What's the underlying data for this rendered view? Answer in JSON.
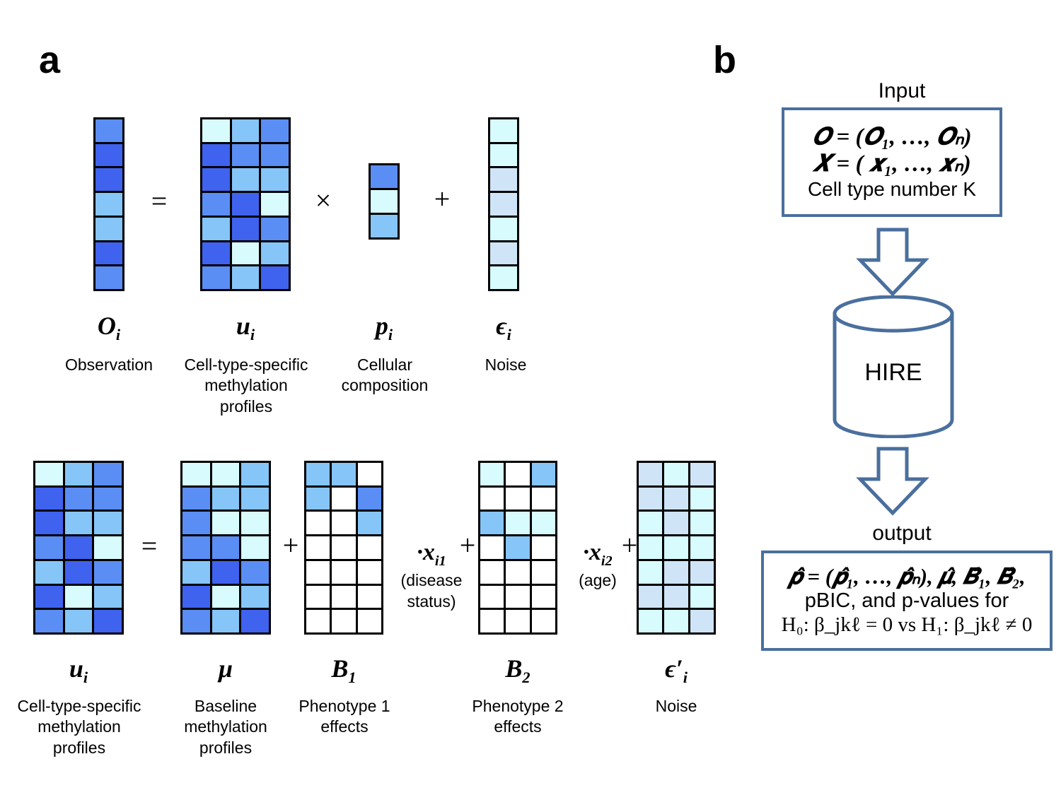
{
  "panels": {
    "a_letter": "a",
    "b_letter": "b"
  },
  "panel_a": {
    "row1": {
      "operators": {
        "equals": "=",
        "times": "×",
        "plus": "+"
      },
      "terms": [
        {
          "symbol_base": "O",
          "symbol_sub": "i",
          "caption": "Observation"
        },
        {
          "symbol_base": "u",
          "symbol_sub": "i",
          "caption": "Cell-type-specific\nmethylation\nprofiles"
        },
        {
          "symbol_base": "p",
          "symbol_sub": "i",
          "caption": "Cellular\ncomposition"
        },
        {
          "symbol_base": "ϵ",
          "symbol_sub": "i",
          "caption": "Noise"
        }
      ]
    },
    "row2": {
      "operators": {
        "equals": "=",
        "plus1": "+",
        "plus2": "+",
        "plus3": "+",
        "dot1": "·",
        "dot2": "·"
      },
      "covariates": [
        {
          "symbol_base": "x",
          "symbol_sub": "i1",
          "note": "(disease\nstatus)"
        },
        {
          "symbol_base": "x",
          "symbol_sub": "i2",
          "note": "(age)"
        }
      ],
      "terms": [
        {
          "symbol_base": "u",
          "symbol_sub": "i",
          "caption": "Cell-type-specific\nmethylation\nprofiles"
        },
        {
          "symbol_base": "μ",
          "symbol_sub": "",
          "caption": "Baseline\nmethylation\nprofiles"
        },
        {
          "symbol_base": "B",
          "symbol_sub": "1",
          "caption": "Phenotype 1\neffects"
        },
        {
          "symbol_base": "B",
          "symbol_sub": "2",
          "caption": "Phenotype 2\neffects"
        },
        {
          "symbol_base": "ϵ′",
          "symbol_sub": "i",
          "caption": "Noise"
        }
      ]
    }
  },
  "panel_b": {
    "input_title": "Input",
    "input_lines": [
      "𝑶 = (𝑶₁, …, 𝑶ₙ)",
      "𝑿 = ( 𝒙₁, …, 𝒙ₙ)",
      "Cell type number K"
    ],
    "process_label": "HIRE",
    "output_title": "output",
    "output_lines": [
      "𝒑̂ = (𝒑̂₁, …, 𝒑̂ₙ), 𝝁̂, 𝑩̂₁, 𝑩̂₂,",
      "pBIC, and p-values for",
      "H₀: β_jkℓ = 0 vs H₁: β_jkℓ ≠ 0"
    ],
    "accent_color": "#4a6f9e"
  },
  "palette": {
    "white": "#ffffff",
    "pale_cyan": "#d8fbfd",
    "pale_blue": "#cfe4f7",
    "light_blue": "#86c5f8",
    "medium_blue": "#5b8ef4",
    "dark_blue": "#3f63ee",
    "border": "#000000"
  },
  "matrix_data": {
    "O_i": {
      "rows": 7,
      "cols": 1,
      "cells": [
        [
          "medium_blue"
        ],
        [
          "dark_blue"
        ],
        [
          "dark_blue"
        ],
        [
          "light_blue"
        ],
        [
          "light_blue"
        ],
        [
          "dark_blue"
        ],
        [
          "medium_blue"
        ]
      ]
    },
    "u_i_top": {
      "rows": 7,
      "cols": 3,
      "cells": [
        [
          "pale_cyan",
          "light_blue",
          "medium_blue"
        ],
        [
          "dark_blue",
          "medium_blue",
          "medium_blue"
        ],
        [
          "dark_blue",
          "light_blue",
          "light_blue"
        ],
        [
          "medium_blue",
          "dark_blue",
          "pale_cyan"
        ],
        [
          "light_blue",
          "dark_blue",
          "medium_blue"
        ],
        [
          "dark_blue",
          "pale_cyan",
          "light_blue"
        ],
        [
          "medium_blue",
          "light_blue",
          "dark_blue"
        ]
      ]
    },
    "p_i": {
      "rows": 3,
      "cols": 1,
      "cells": [
        [
          "medium_blue"
        ],
        [
          "pale_cyan"
        ],
        [
          "light_blue"
        ]
      ]
    },
    "eps_i": {
      "rows": 7,
      "cols": 1,
      "cells": [
        [
          "pale_cyan"
        ],
        [
          "pale_cyan"
        ],
        [
          "pale_blue"
        ],
        [
          "pale_blue"
        ],
        [
          "pale_cyan"
        ],
        [
          "pale_blue"
        ],
        [
          "pale_cyan"
        ]
      ]
    },
    "u_i_bottom": {
      "rows": 7,
      "cols": 3,
      "cells": [
        [
          "pale_cyan",
          "light_blue",
          "medium_blue"
        ],
        [
          "dark_blue",
          "medium_blue",
          "medium_blue"
        ],
        [
          "dark_blue",
          "light_blue",
          "light_blue"
        ],
        [
          "medium_blue",
          "dark_blue",
          "pale_cyan"
        ],
        [
          "light_blue",
          "dark_blue",
          "medium_blue"
        ],
        [
          "dark_blue",
          "pale_cyan",
          "light_blue"
        ],
        [
          "medium_blue",
          "light_blue",
          "dark_blue"
        ]
      ]
    },
    "mu": {
      "rows": 7,
      "cols": 3,
      "cells": [
        [
          "pale_cyan",
          "pale_cyan",
          "light_blue"
        ],
        [
          "medium_blue",
          "light_blue",
          "light_blue"
        ],
        [
          "medium_blue",
          "pale_cyan",
          "pale_cyan"
        ],
        [
          "medium_blue",
          "medium_blue",
          "pale_cyan"
        ],
        [
          "light_blue",
          "dark_blue",
          "medium_blue"
        ],
        [
          "dark_blue",
          "pale_cyan",
          "light_blue"
        ],
        [
          "medium_blue",
          "light_blue",
          "dark_blue"
        ]
      ]
    },
    "B_1": {
      "rows": 7,
      "cols": 3,
      "cells": [
        [
          "light_blue",
          "light_blue",
          "white"
        ],
        [
          "light_blue",
          "white",
          "medium_blue"
        ],
        [
          "white",
          "white",
          "light_blue"
        ],
        [
          "white",
          "white",
          "white"
        ],
        [
          "white",
          "white",
          "white"
        ],
        [
          "white",
          "white",
          "white"
        ],
        [
          "white",
          "white",
          "white"
        ]
      ]
    },
    "B_2": {
      "rows": 7,
      "cols": 3,
      "cells": [
        [
          "pale_cyan",
          "white",
          "light_blue"
        ],
        [
          "white",
          "white",
          "white"
        ],
        [
          "light_blue",
          "pale_cyan",
          "pale_cyan"
        ],
        [
          "white",
          "light_blue",
          "white"
        ],
        [
          "white",
          "white",
          "white"
        ],
        [
          "white",
          "white",
          "white"
        ],
        [
          "white",
          "white",
          "white"
        ]
      ]
    },
    "eps_prime": {
      "rows": 7,
      "cols": 3,
      "cells": [
        [
          "pale_blue",
          "pale_cyan",
          "pale_blue"
        ],
        [
          "pale_blue",
          "pale_blue",
          "pale_cyan"
        ],
        [
          "pale_cyan",
          "pale_blue",
          "pale_cyan"
        ],
        [
          "pale_cyan",
          "pale_cyan",
          "pale_cyan"
        ],
        [
          "pale_cyan",
          "pale_blue",
          "pale_blue"
        ],
        [
          "pale_blue",
          "pale_blue",
          "pale_cyan"
        ],
        [
          "pale_cyan",
          "pale_cyan",
          "pale_blue"
        ]
      ]
    }
  }
}
